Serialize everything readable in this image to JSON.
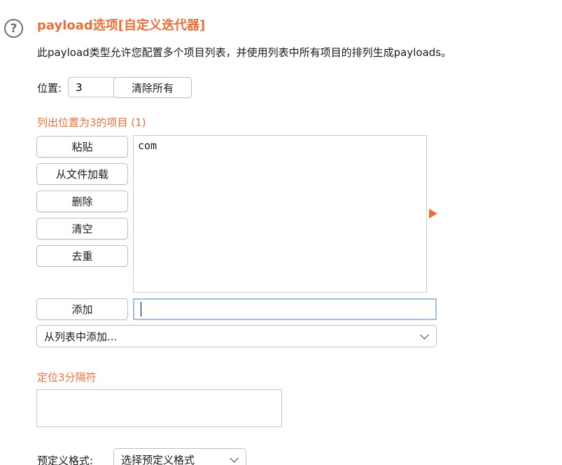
{
  "header": {
    "help_icon_glyph": "?",
    "title": "payload选项[自定义迭代器]",
    "description": "此payload类型允许您配置多个项目列表，并使用列表中所有项目的排列生成payloads。"
  },
  "position": {
    "label": "位置:",
    "value": "3",
    "clear_all_label": "清除所有"
  },
  "list": {
    "label": "列出位置为3的项目 (1)",
    "buttons": {
      "paste": "粘贴",
      "load_from_file": "从文件加载",
      "remove": "删除",
      "clear": "清空",
      "deduplicate": "去重"
    },
    "items": [
      "com"
    ],
    "add_label": "添加",
    "add_value": "",
    "add_from_list": "从列表中添加..."
  },
  "separator": {
    "label": "定位3分隔符",
    "value": ""
  },
  "predefined_format": {
    "label": "预定义格式:",
    "selected": "选择预定义格式"
  },
  "colors": {
    "accent": "#e8703a",
    "input_focus_border": "#9cc0e6"
  }
}
